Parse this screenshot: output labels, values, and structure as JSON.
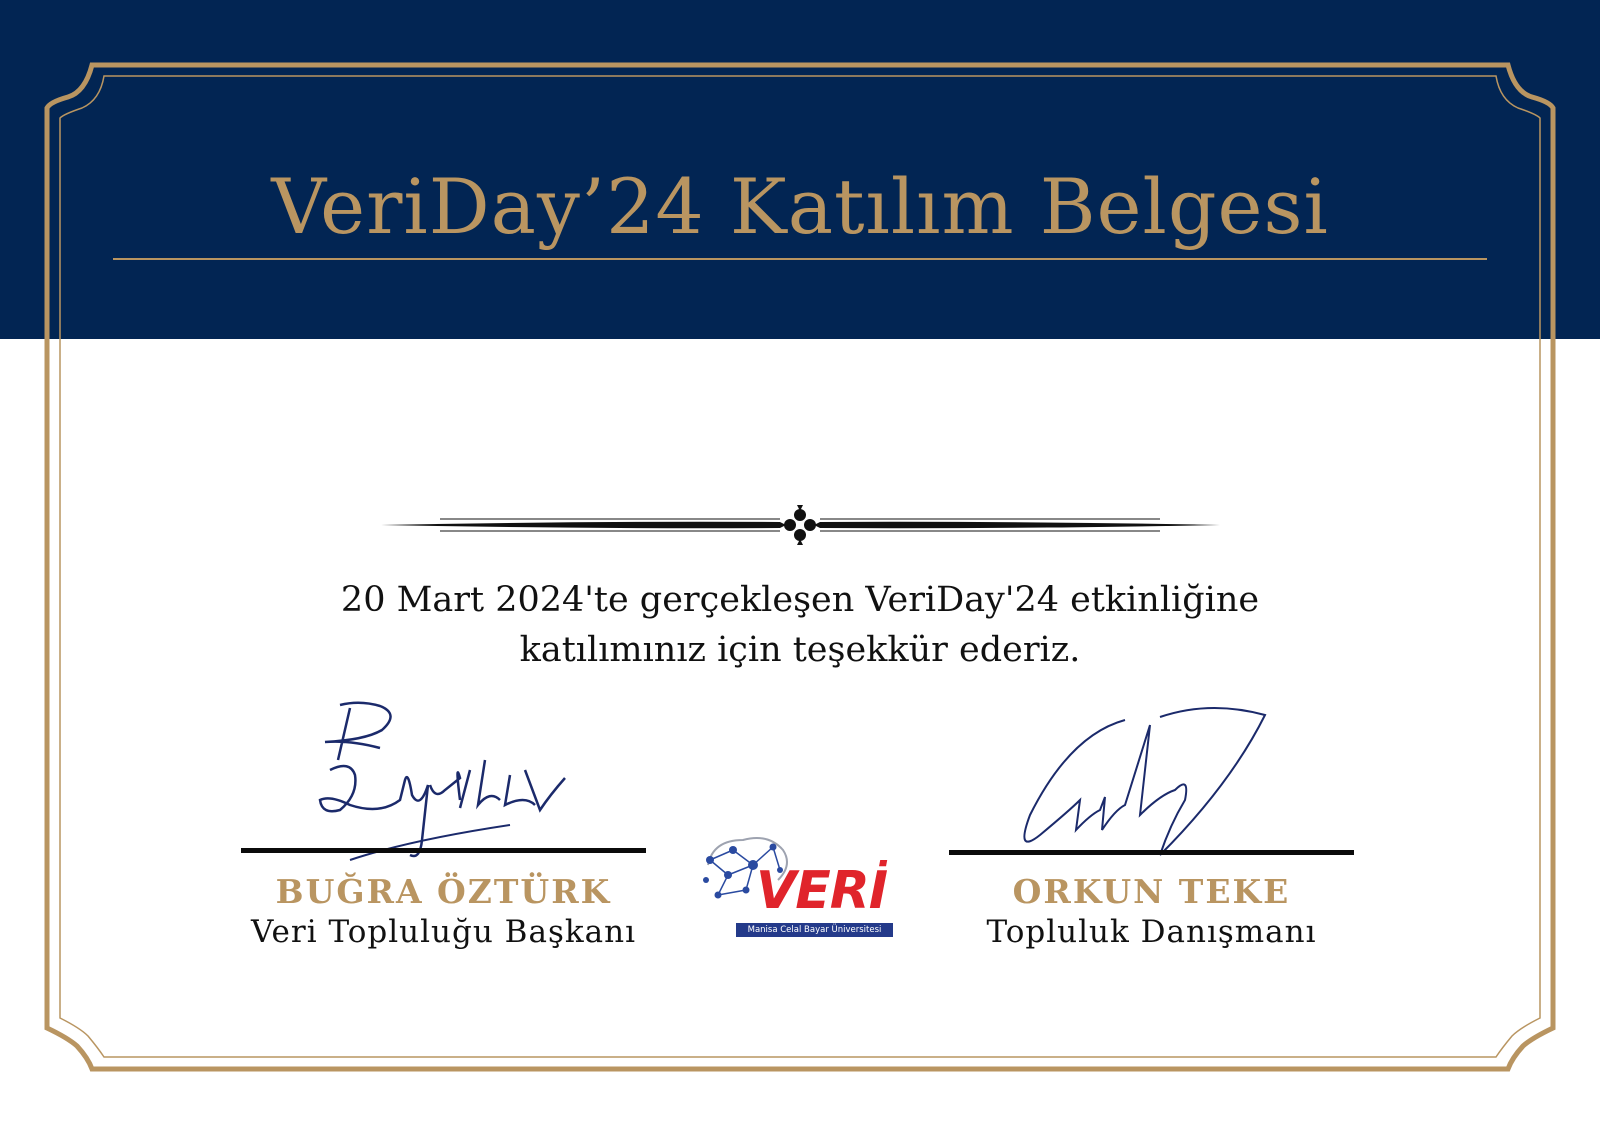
{
  "certificate": {
    "title": "VeriDay’24 Katılım Belgesi",
    "body_line_1": "20 Mart 2024'te gerçekleşen VeriDay'24 etkinliğine",
    "body_line_2": "katılımınız için teşekkür ederiz."
  },
  "signatories": {
    "left": {
      "name": "BUĞRA ÖZTÜRK",
      "role": "Veri Topluluğu Başkanı"
    },
    "right": {
      "name": "ORKUN TEKE",
      "role": "Topluluk Danışmanı"
    }
  },
  "logo": {
    "word": "VERİ",
    "subtitle": "Manisa Celal Bayar Üniversitesi"
  },
  "colors": {
    "navy": "#022553",
    "gold": "#b99561",
    "logo_red": "#e0242b",
    "logo_blue": "#243a8a"
  }
}
